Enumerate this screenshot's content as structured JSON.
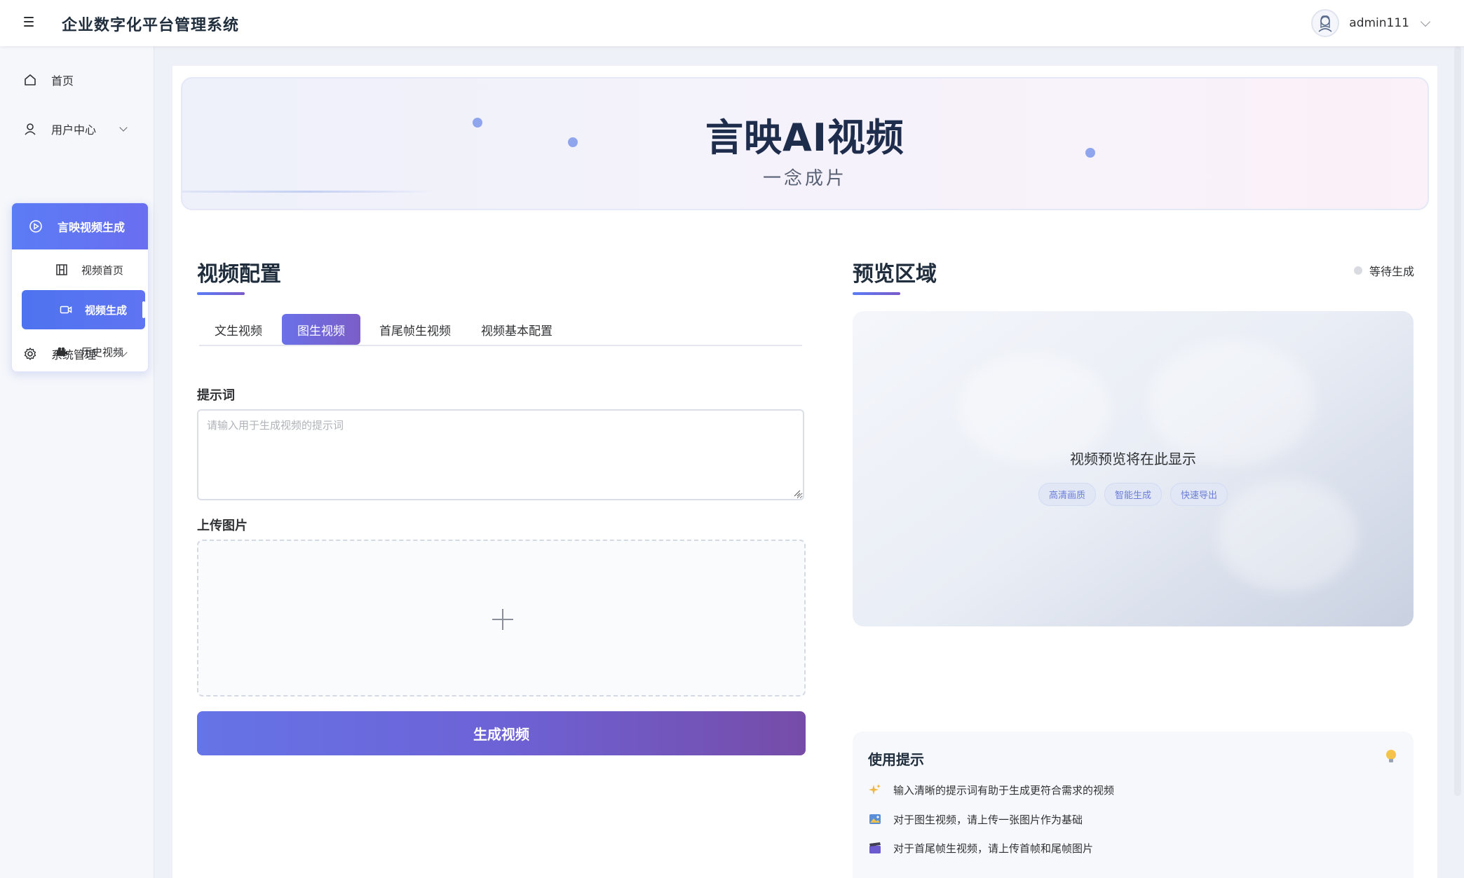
{
  "header": {
    "title": "企业数字化平台管理系统",
    "username": "admin111"
  },
  "sidebar": {
    "items": [
      {
        "label": "首页",
        "icon": "home-icon"
      },
      {
        "label": "用户中心",
        "icon": "user-icon"
      },
      {
        "label": "系统管理",
        "icon": "gear-icon"
      }
    ],
    "submenu": {
      "label": "言映视频生成",
      "icon": "play-circle-icon",
      "items": [
        {
          "label": "视频首页",
          "icon": "film-icon"
        },
        {
          "label": "视频生成",
          "icon": "video-camera-icon",
          "active": true
        },
        {
          "label": "历史视频",
          "icon": "camera-icon"
        }
      ]
    }
  },
  "banner": {
    "title": "言映AI视频",
    "subtitle": "一念成片"
  },
  "config": {
    "title": "视频配置",
    "tabs": [
      {
        "label": "文生视频"
      },
      {
        "label": "图生视频",
        "active": true
      },
      {
        "label": "首尾帧生视频"
      },
      {
        "label": "视频基本配置"
      }
    ],
    "prompt_label": "提示词",
    "prompt_placeholder": "请输入用于生成视频的提示词",
    "prompt_value": "",
    "upload_label": "上传图片",
    "generate_label": "生成视频"
  },
  "preview": {
    "title": "预览区域",
    "status": "等待生成",
    "placeholder": "视频预览将在此显示",
    "chips": [
      "高清画质",
      "智能生成",
      "快速导出"
    ]
  },
  "tips": {
    "title": "使用提示",
    "items": [
      {
        "icon": "sparkle-icon",
        "text": "输入清晰的提示词有助于生成更符合需求的视频"
      },
      {
        "icon": "picture-icon",
        "text": "对于图生视频，请上传一张图片作为基础"
      },
      {
        "icon": "clapper-icon",
        "text": "对于首尾帧生视频，请上传首帧和尾帧图片"
      }
    ]
  },
  "colors": {
    "accent": "#5b7cf5",
    "accent_purple": "#764ca8",
    "active_menu": "#4e73f0"
  }
}
